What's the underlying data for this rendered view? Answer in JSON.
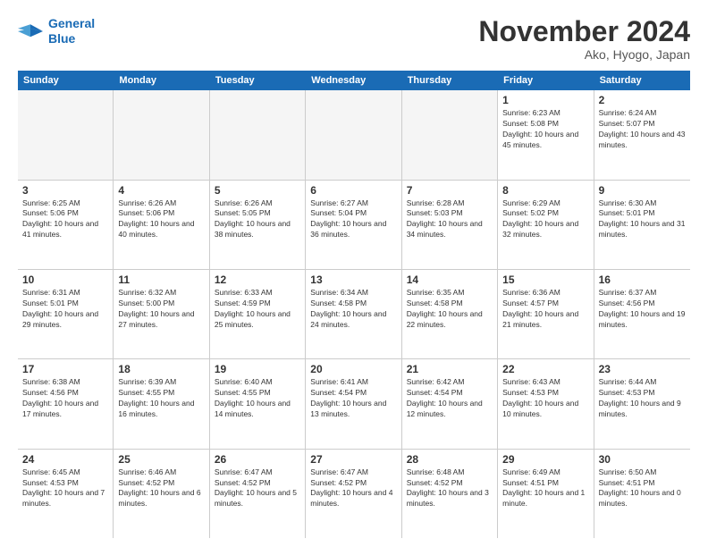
{
  "logo": {
    "line1": "General",
    "line2": "Blue"
  },
  "title": "November 2024",
  "location": "Ako, Hyogo, Japan",
  "days_of_week": [
    "Sunday",
    "Monday",
    "Tuesday",
    "Wednesday",
    "Thursday",
    "Friday",
    "Saturday"
  ],
  "weeks": [
    [
      {
        "day": "",
        "empty": true
      },
      {
        "day": "",
        "empty": true
      },
      {
        "day": "",
        "empty": true
      },
      {
        "day": "",
        "empty": true
      },
      {
        "day": "",
        "empty": true
      },
      {
        "day": "1",
        "sunrise": "6:23 AM",
        "sunset": "5:08 PM",
        "daylight": "Daylight: 10 hours and 45 minutes."
      },
      {
        "day": "2",
        "sunrise": "6:24 AM",
        "sunset": "5:07 PM",
        "daylight": "Daylight: 10 hours and 43 minutes."
      }
    ],
    [
      {
        "day": "3",
        "sunrise": "6:25 AM",
        "sunset": "5:06 PM",
        "daylight": "Daylight: 10 hours and 41 minutes."
      },
      {
        "day": "4",
        "sunrise": "6:26 AM",
        "sunset": "5:06 PM",
        "daylight": "Daylight: 10 hours and 40 minutes."
      },
      {
        "day": "5",
        "sunrise": "6:26 AM",
        "sunset": "5:05 PM",
        "daylight": "Daylight: 10 hours and 38 minutes."
      },
      {
        "day": "6",
        "sunrise": "6:27 AM",
        "sunset": "5:04 PM",
        "daylight": "Daylight: 10 hours and 36 minutes."
      },
      {
        "day": "7",
        "sunrise": "6:28 AM",
        "sunset": "5:03 PM",
        "daylight": "Daylight: 10 hours and 34 minutes."
      },
      {
        "day": "8",
        "sunrise": "6:29 AM",
        "sunset": "5:02 PM",
        "daylight": "Daylight: 10 hours and 32 minutes."
      },
      {
        "day": "9",
        "sunrise": "6:30 AM",
        "sunset": "5:01 PM",
        "daylight": "Daylight: 10 hours and 31 minutes."
      }
    ],
    [
      {
        "day": "10",
        "sunrise": "6:31 AM",
        "sunset": "5:01 PM",
        "daylight": "Daylight: 10 hours and 29 minutes."
      },
      {
        "day": "11",
        "sunrise": "6:32 AM",
        "sunset": "5:00 PM",
        "daylight": "Daylight: 10 hours and 27 minutes."
      },
      {
        "day": "12",
        "sunrise": "6:33 AM",
        "sunset": "4:59 PM",
        "daylight": "Daylight: 10 hours and 25 minutes."
      },
      {
        "day": "13",
        "sunrise": "6:34 AM",
        "sunset": "4:58 PM",
        "daylight": "Daylight: 10 hours and 24 minutes."
      },
      {
        "day": "14",
        "sunrise": "6:35 AM",
        "sunset": "4:58 PM",
        "daylight": "Daylight: 10 hours and 22 minutes."
      },
      {
        "day": "15",
        "sunrise": "6:36 AM",
        "sunset": "4:57 PM",
        "daylight": "Daylight: 10 hours and 21 minutes."
      },
      {
        "day": "16",
        "sunrise": "6:37 AM",
        "sunset": "4:56 PM",
        "daylight": "Daylight: 10 hours and 19 minutes."
      }
    ],
    [
      {
        "day": "17",
        "sunrise": "6:38 AM",
        "sunset": "4:56 PM",
        "daylight": "Daylight: 10 hours and 17 minutes."
      },
      {
        "day": "18",
        "sunrise": "6:39 AM",
        "sunset": "4:55 PM",
        "daylight": "Daylight: 10 hours and 16 minutes."
      },
      {
        "day": "19",
        "sunrise": "6:40 AM",
        "sunset": "4:55 PM",
        "daylight": "Daylight: 10 hours and 14 minutes."
      },
      {
        "day": "20",
        "sunrise": "6:41 AM",
        "sunset": "4:54 PM",
        "daylight": "Daylight: 10 hours and 13 minutes."
      },
      {
        "day": "21",
        "sunrise": "6:42 AM",
        "sunset": "4:54 PM",
        "daylight": "Daylight: 10 hours and 12 minutes."
      },
      {
        "day": "22",
        "sunrise": "6:43 AM",
        "sunset": "4:53 PM",
        "daylight": "Daylight: 10 hours and 10 minutes."
      },
      {
        "day": "23",
        "sunrise": "6:44 AM",
        "sunset": "4:53 PM",
        "daylight": "Daylight: 10 hours and 9 minutes."
      }
    ],
    [
      {
        "day": "24",
        "sunrise": "6:45 AM",
        "sunset": "4:53 PM",
        "daylight": "Daylight: 10 hours and 7 minutes."
      },
      {
        "day": "25",
        "sunrise": "6:46 AM",
        "sunset": "4:52 PM",
        "daylight": "Daylight: 10 hours and 6 minutes."
      },
      {
        "day": "26",
        "sunrise": "6:47 AM",
        "sunset": "4:52 PM",
        "daylight": "Daylight: 10 hours and 5 minutes."
      },
      {
        "day": "27",
        "sunrise": "6:47 AM",
        "sunset": "4:52 PM",
        "daylight": "Daylight: 10 hours and 4 minutes."
      },
      {
        "day": "28",
        "sunrise": "6:48 AM",
        "sunset": "4:52 PM",
        "daylight": "Daylight: 10 hours and 3 minutes."
      },
      {
        "day": "29",
        "sunrise": "6:49 AM",
        "sunset": "4:51 PM",
        "daylight": "Daylight: 10 hours and 1 minute."
      },
      {
        "day": "30",
        "sunrise": "6:50 AM",
        "sunset": "4:51 PM",
        "daylight": "Daylight: 10 hours and 0 minutes."
      }
    ]
  ]
}
